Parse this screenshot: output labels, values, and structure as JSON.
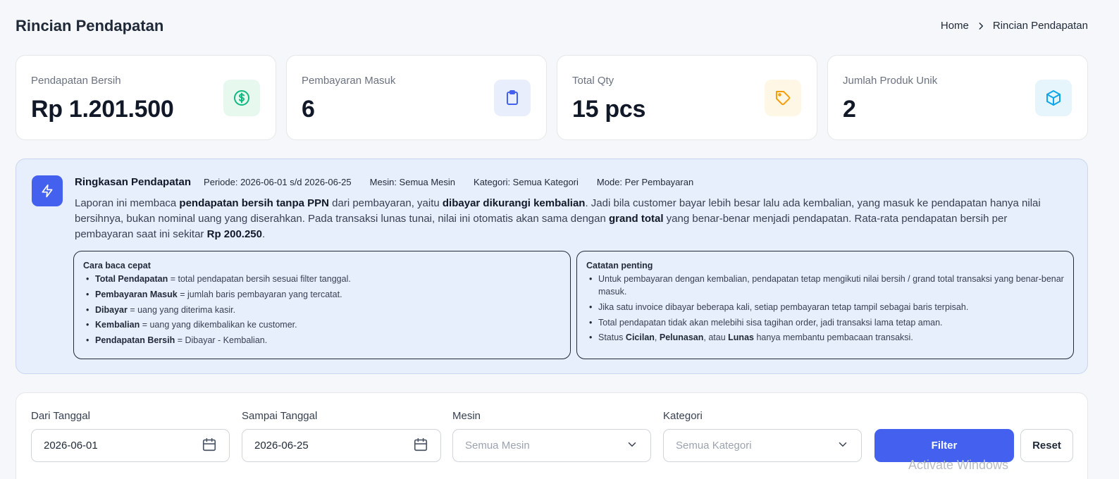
{
  "header": {
    "title": "Rincian Pendapatan",
    "breadcrumb": [
      "Home",
      "Rincian Pendapatan"
    ]
  },
  "stats": [
    {
      "label": "Pendapatan Bersih",
      "value": "Rp 1.201.500",
      "icon": "dollar-circle-icon",
      "icon_color": "#10b981",
      "icon_bg": "#e7f8ef"
    },
    {
      "label": "Pembayaran Masuk",
      "value": "6",
      "icon": "clipboard-icon",
      "icon_color": "#4361ee",
      "icon_bg": "#e8eefc"
    },
    {
      "label": "Total Qty",
      "value": "15 pcs",
      "icon": "tag-icon",
      "icon_color": "#f59e0b",
      "icon_bg": "#fff7e6"
    },
    {
      "label": "Jumlah Produk Unik",
      "value": "2",
      "icon": "cube-icon",
      "icon_color": "#0ea5e9",
      "icon_bg": "#e6f5fb"
    }
  ],
  "summary": {
    "title": "Ringkasan Pendapatan",
    "periode": "Periode: 2026-06-01 s/d 2026-06-25",
    "mesin": "Mesin: Semua Mesin",
    "kategori": "Kategori: Semua Kategori",
    "mode": "Mode: Per Pembayaran",
    "text_parts": [
      "Laporan ini membaca ",
      "pendapatan bersih tanpa PPN",
      " dari pembayaran, yaitu ",
      "dibayar dikurangi kembalian",
      ". Jadi bila customer bayar lebih besar lalu ada kembalian, yang masuk ke pendapatan hanya nilai bersihnya, bukan nominal uang yang diserahkan. Pada transaksi lunas tunai, nilai ini otomatis akan sama dengan ",
      "grand total",
      " yang benar-benar menjadi pendapatan. Rata-rata pendapatan bersih per pembayaran saat ini sekitar ",
      "Rp 200.250",
      "."
    ],
    "quick_read": {
      "title": "Cara baca cepat",
      "items": [
        {
          "term": "Total Pendapatan",
          "desc": " = total pendapatan bersih sesuai filter tanggal."
        },
        {
          "term": "Pembayaran Masuk",
          "desc": " = jumlah baris pembayaran yang tercatat."
        },
        {
          "term": "Dibayar",
          "desc": " = uang yang diterima kasir."
        },
        {
          "term": "Kembalian",
          "desc": " = uang yang dikembalikan ke customer."
        },
        {
          "term": "Pendapatan Bersih",
          "desc": " = Dibayar - Kembalian."
        }
      ]
    },
    "notes": {
      "title": "Catatan penting",
      "items": [
        "Untuk pembayaran dengan kembalian, pendapatan tetap mengikuti nilai bersih / grand total transaksi yang benar-benar masuk.",
        "Jika satu invoice dibayar beberapa kali, setiap pembayaran tetap tampil sebagai baris terpisah.",
        "Total pendapatan tidak akan melebihi sisa tagihan order, jadi transaksi lama tetap aman."
      ],
      "status_parts": [
        "Status ",
        "Cicilan",
        ", ",
        "Pelunasan",
        ", atau ",
        "Lunas",
        " hanya membantu pembacaan transaksi."
      ]
    }
  },
  "filters": {
    "from_label": "Dari Tanggal",
    "from_value": "2026-06-01",
    "to_label": "Sampai Tanggal",
    "to_value": "2026-06-25",
    "machine_label": "Mesin",
    "machine_placeholder": "Semua Mesin",
    "category_label": "Kategori",
    "category_placeholder": "Semua Kategori",
    "filter_button": "Filter",
    "reset_button": "Reset"
  },
  "watermark": "Activate Windows"
}
